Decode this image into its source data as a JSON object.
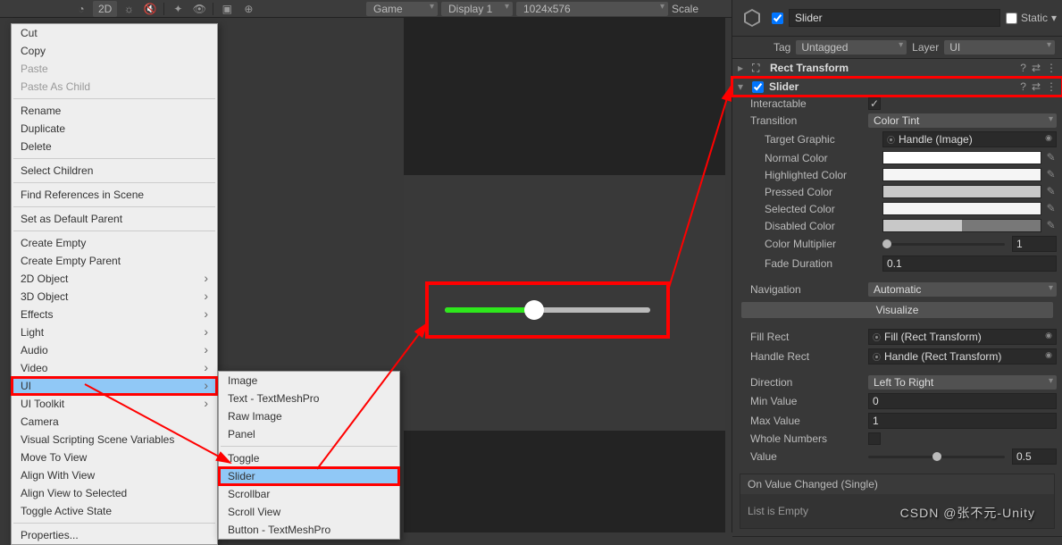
{
  "toolbar": {
    "mode_2d": "2D",
    "view_dropdown": "Game",
    "display_dropdown": "Display 1",
    "resolution_dropdown": "1024x576",
    "scale_label": "Scale"
  },
  "context_menu": {
    "items": [
      {
        "label": "Cut"
      },
      {
        "label": "Copy"
      },
      {
        "label": "Paste",
        "disabled": true
      },
      {
        "label": "Paste As Child",
        "disabled": true
      },
      {
        "sep": true
      },
      {
        "label": "Rename"
      },
      {
        "label": "Duplicate"
      },
      {
        "label": "Delete"
      },
      {
        "sep": true
      },
      {
        "label": "Select Children"
      },
      {
        "sep": true
      },
      {
        "label": "Find References in Scene"
      },
      {
        "sep": true
      },
      {
        "label": "Set as Default Parent"
      },
      {
        "sep": true
      },
      {
        "label": "Create Empty"
      },
      {
        "label": "Create Empty Parent"
      },
      {
        "label": "2D Object",
        "arrow": true
      },
      {
        "label": "3D Object",
        "arrow": true
      },
      {
        "label": "Effects",
        "arrow": true
      },
      {
        "label": "Light",
        "arrow": true
      },
      {
        "label": "Audio",
        "arrow": true
      },
      {
        "label": "Video",
        "arrow": true
      },
      {
        "label": "UI",
        "arrow": true,
        "highlighted": true,
        "boxed": true
      },
      {
        "label": "UI Toolkit",
        "arrow": true
      },
      {
        "label": "Camera"
      },
      {
        "label": "Visual Scripting Scene Variables"
      },
      {
        "label": "Move To View"
      },
      {
        "label": "Align With View"
      },
      {
        "label": "Align View to Selected"
      },
      {
        "label": "Toggle Active State"
      },
      {
        "sep": true
      },
      {
        "label": "Properties..."
      }
    ]
  },
  "submenu": {
    "items": [
      {
        "label": "Image"
      },
      {
        "label": "Text - TextMeshPro"
      },
      {
        "label": "Raw Image"
      },
      {
        "label": "Panel"
      },
      {
        "sep": true
      },
      {
        "label": "Toggle"
      },
      {
        "label": "Slider",
        "highlighted": true,
        "boxed": true
      },
      {
        "label": "Scrollbar"
      },
      {
        "label": "Scroll View"
      },
      {
        "label": "Button - TextMeshPro"
      }
    ]
  },
  "inspector": {
    "name": "Slider",
    "static_label": "Static",
    "tag_label": "Tag",
    "tag_value": "Untagged",
    "layer_label": "Layer",
    "layer_value": "UI",
    "rect_transform": "Rect Transform",
    "slider_component": "Slider",
    "props": {
      "interactable_label": "Interactable",
      "transition_label": "Transition",
      "transition_value": "Color Tint",
      "target_graphic_label": "Target Graphic",
      "target_graphic_value": "Handle (Image)",
      "normal_color_label": "Normal Color",
      "highlighted_color_label": "Highlighted Color",
      "pressed_color_label": "Pressed Color",
      "selected_color_label": "Selected Color",
      "disabled_color_label": "Disabled Color",
      "color_multiplier_label": "Color Multiplier",
      "color_multiplier_value": "1",
      "fade_duration_label": "Fade Duration",
      "fade_duration_value": "0.1",
      "navigation_label": "Navigation",
      "navigation_value": "Automatic",
      "visualize_label": "Visualize",
      "fill_rect_label": "Fill Rect",
      "fill_rect_value": "Fill (Rect Transform)",
      "handle_rect_label": "Handle Rect",
      "handle_rect_value": "Handle (Rect Transform)",
      "direction_label": "Direction",
      "direction_value": "Left To Right",
      "min_value_label": "Min Value",
      "min_value_value": "0",
      "max_value_label": "Max Value",
      "max_value_value": "1",
      "whole_numbers_label": "Whole Numbers",
      "value_label": "Value",
      "value_value": "0.5"
    },
    "event": {
      "header": "On Value Changed (Single)",
      "body": "List is Empty"
    }
  },
  "watermark": "CSDN @张不元-Unity"
}
